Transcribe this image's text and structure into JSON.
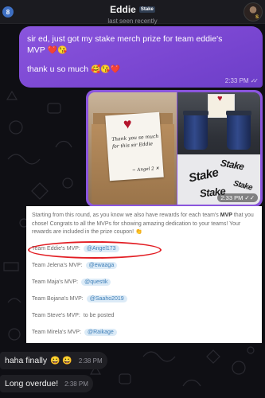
{
  "header": {
    "back_badge": "8",
    "contact_name": "Eddie",
    "name_badge": "Stake",
    "status": "last seen recently",
    "avatar_badge": "S"
  },
  "outgoing_text": {
    "line1": "sir ed, just got my stake merch prize for team eddie's",
    "line2_text": "MVP",
    "line2_emoji": "❤️😘",
    "line3_text": "thank u so much",
    "line3_emoji": "🥰😘❤️",
    "time": "2:33 PM",
    "read_state": "read"
  },
  "photo": {
    "note_text": "Thank you so much for this sir Eddie",
    "note_signature": "~ Angel 2 ✕",
    "logo_text": "Stake",
    "time": "2:33 PM"
  },
  "screenshot": {
    "intro_pre": "Starting from this round, as you know we also have rewards for each team's",
    "intro_bold": "MVP",
    "intro_post": "that you chose! Congrats to all the MVPs for showing amazing dedication to your teams! Your rewards are included in the prize coupon! 👏",
    "mvps": [
      {
        "team": "Team Eddie's MVP:",
        "user": "@Angel173",
        "tagged": true
      },
      {
        "team": "Team Jelena's MVP:",
        "user": "@ewaaga",
        "tagged": true
      },
      {
        "team": "Team Maja's MVP:",
        "user": "@questik",
        "tagged": true
      },
      {
        "team": "Team Bojana's MVP:",
        "user": "@Saaho2019",
        "tagged": true
      },
      {
        "team": "Team Steve's MVP:",
        "user": "to be posted",
        "tagged": false
      },
      {
        "team": "Team Mirela's MVP:",
        "user": "@Raikage",
        "tagged": true
      }
    ],
    "highlight_color": "#e21c22"
  },
  "incoming": [
    {
      "text": "haha finally",
      "emoji": "😀 😀",
      "time": "2:38 PM"
    },
    {
      "text": "Long overdue!",
      "emoji": "",
      "time": "2:38 PM"
    }
  ],
  "colors": {
    "outgoing_bubble": "#8a55dd",
    "incoming_bubble": "#1f1f24",
    "background": "#0f0f14",
    "mention_chip": "#dcebf7"
  }
}
